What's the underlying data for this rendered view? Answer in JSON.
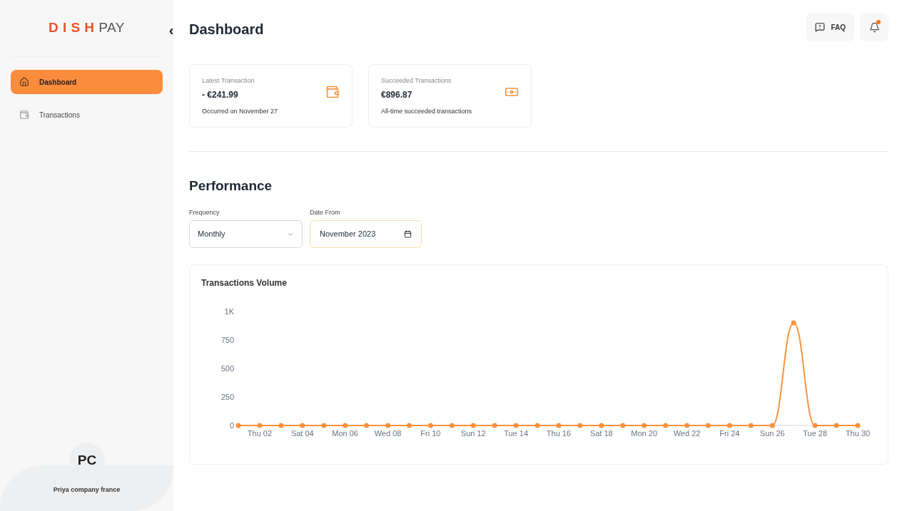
{
  "sidebar": {
    "logo": {
      "brand": "D I S H",
      "product": "PAY"
    },
    "collapse_glyph": "‹",
    "items": [
      {
        "label": "Dashboard",
        "selected": true
      },
      {
        "label": "Transactions",
        "selected": false
      }
    ],
    "profile": {
      "initials": "PC",
      "name": "Priya company france"
    }
  },
  "header": {
    "title": "Dashboard",
    "faq": "FAQ"
  },
  "cards": [
    {
      "title": "Latest Transaction",
      "amount": "- €241.99",
      "note": "Occurred on November 27"
    },
    {
      "title": "Succeeded Transactions",
      "amount": "€896.87",
      "note": "All-time succeeded transactions"
    }
  ],
  "performance": {
    "title": "Performance",
    "frequency": {
      "label": "Frequency",
      "value": "Monthly"
    },
    "date_from": {
      "label": "Date From",
      "value": "November 2023"
    },
    "chart": {
      "title": "Transactions Volume",
      "chart_data": {
        "type": "line",
        "categories": [
          null,
          "Thu 02",
          null,
          "Sat 04",
          null,
          "Mon 06",
          null,
          "Wed 08",
          null,
          "Fri 10",
          null,
          "Sun 12",
          null,
          "Tue 14",
          null,
          "Thu 16",
          null,
          "Sat 18",
          null,
          "Mon 20",
          null,
          "Wed 22",
          null,
          "Fri 24",
          null,
          "Sun 26",
          null,
          "Tue 28",
          null,
          "Thu 30"
        ],
        "series": [
          {
            "color": "#fb923c",
            "marker": true,
            "values": [
              0,
              0,
              0,
              0,
              0,
              0,
              0,
              0,
              0,
              0,
              0,
              0,
              0,
              0,
              0,
              0,
              0,
              0,
              0,
              0,
              0,
              0,
              0,
              0,
              0,
              0,
              900,
              0,
              0,
              0
            ]
          }
        ],
        "ylim": [
          0,
          1000
        ],
        "yticks": [
          0,
          250,
          500,
          750,
          {
            "value": 1000,
            "label": "1K"
          }
        ]
      }
    }
  }
}
